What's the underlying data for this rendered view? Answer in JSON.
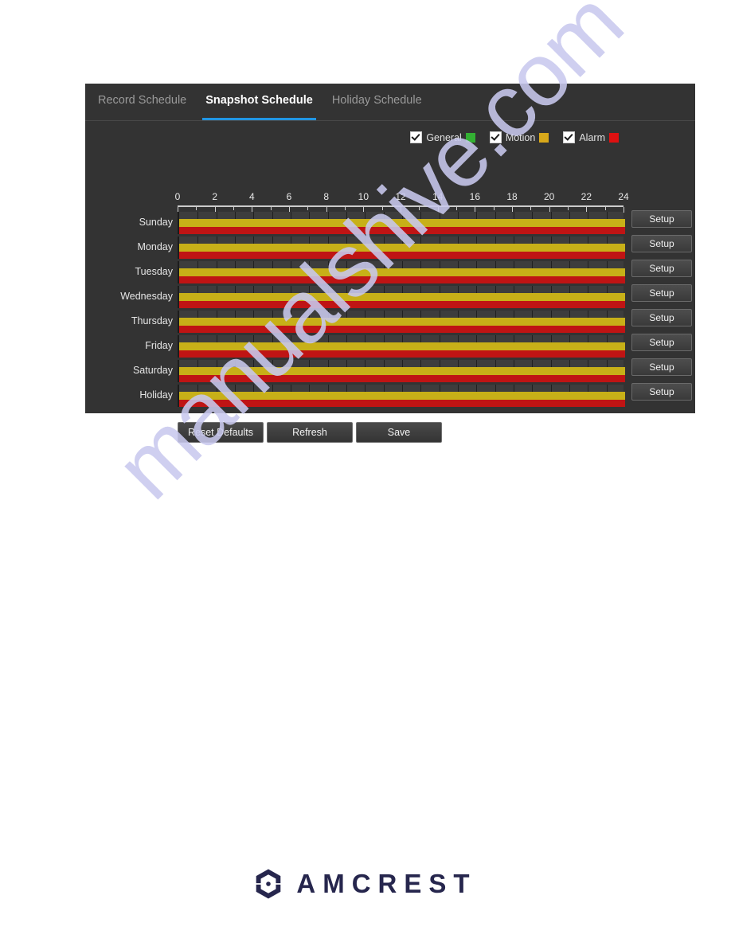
{
  "page": {
    "watermark_text": "manualshive.com",
    "watermark_color": "#c9c9ee",
    "background": "#ffffff"
  },
  "panel": {
    "background": "#333333",
    "accent": "#2196e3"
  },
  "tabs": [
    {
      "label": "Record Schedule",
      "active": false
    },
    {
      "label": "Snapshot Schedule",
      "active": true
    },
    {
      "label": "Holiday Schedule",
      "active": false
    }
  ],
  "legend": {
    "items": [
      {
        "label": "General",
        "color": "#33b033",
        "checked": true
      },
      {
        "label": "Motion",
        "color": "#d8a81a",
        "checked": true
      },
      {
        "label": "Alarm",
        "color": "#dd1111",
        "checked": true
      }
    ]
  },
  "timeline": {
    "axis_labels": [
      "0",
      "2",
      "4",
      "6",
      "8",
      "10",
      "12",
      "14",
      "16",
      "18",
      "20",
      "22",
      "24"
    ],
    "hours_min": 0,
    "hours_max": 24,
    "setup_label": "Setup",
    "track_bg": "#3d3d3d",
    "colors": {
      "general": "#33b033",
      "motion": "#c7b018",
      "alarm": "#bf1414"
    }
  },
  "chart_data": {
    "type": "bar",
    "title": "Snapshot Schedule",
    "xlabel": "",
    "ylabel": "",
    "xlim": [
      0,
      24
    ],
    "grid": true,
    "legend_position": "top-right",
    "categories": [
      "Sunday",
      "Monday",
      "Tuesday",
      "Wednesday",
      "Thursday",
      "Friday",
      "Saturday",
      "Holiday"
    ],
    "series": [
      {
        "name": "General",
        "color": "#33b033",
        "spans": [
          [],
          [],
          [],
          [],
          [],
          [],
          [],
          []
        ]
      },
      {
        "name": "Motion",
        "color": "#c7b018",
        "spans": [
          [
            [
              0,
              24
            ]
          ],
          [
            [
              0,
              24
            ]
          ],
          [
            [
              0,
              24
            ]
          ],
          [
            [
              0,
              24
            ]
          ],
          [
            [
              0,
              24
            ]
          ],
          [
            [
              0,
              24
            ]
          ],
          [
            [
              0,
              24
            ]
          ],
          [
            [
              0,
              24
            ]
          ]
        ]
      },
      {
        "name": "Alarm",
        "color": "#bf1414",
        "spans": [
          [
            [
              0,
              24
            ]
          ],
          [
            [
              0,
              24
            ]
          ],
          [
            [
              0,
              24
            ]
          ],
          [
            [
              0,
              24
            ]
          ],
          [
            [
              0,
              24
            ]
          ],
          [
            [
              0,
              24
            ]
          ],
          [
            [
              0,
              24
            ]
          ],
          [
            [
              0,
              24
            ]
          ]
        ]
      }
    ]
  },
  "rows": [
    {
      "day": "Sunday",
      "setup": "Setup",
      "general": [],
      "motion": [
        [
          0,
          24
        ]
      ],
      "alarm": [
        [
          0,
          24
        ]
      ]
    },
    {
      "day": "Monday",
      "setup": "Setup",
      "general": [],
      "motion": [
        [
          0,
          24
        ]
      ],
      "alarm": [
        [
          0,
          24
        ]
      ]
    },
    {
      "day": "Tuesday",
      "setup": "Setup",
      "general": [],
      "motion": [
        [
          0,
          24
        ]
      ],
      "alarm": [
        [
          0,
          24
        ]
      ]
    },
    {
      "day": "Wednesday",
      "setup": "Setup",
      "general": [],
      "motion": [
        [
          0,
          24
        ]
      ],
      "alarm": [
        [
          0,
          24
        ]
      ]
    },
    {
      "day": "Thursday",
      "setup": "Setup",
      "general": [],
      "motion": [
        [
          0,
          24
        ]
      ],
      "alarm": [
        [
          0,
          24
        ]
      ]
    },
    {
      "day": "Friday",
      "setup": "Setup",
      "general": [],
      "motion": [
        [
          0,
          24
        ]
      ],
      "alarm": [
        [
          0,
          24
        ]
      ]
    },
    {
      "day": "Saturday",
      "setup": "Setup",
      "general": [],
      "motion": [
        [
          0,
          24
        ]
      ],
      "alarm": [
        [
          0,
          24
        ]
      ]
    },
    {
      "day": "Holiday",
      "setup": "Setup",
      "general": [],
      "motion": [
        [
          0,
          24
        ]
      ],
      "alarm": [
        [
          0,
          24
        ]
      ]
    }
  ],
  "actions": [
    {
      "label": "Reset Defaults"
    },
    {
      "label": "Refresh"
    },
    {
      "label": "Save"
    }
  ],
  "footer": {
    "brand": "AMCREST",
    "brand_color": "#26264d",
    "logo_icon": "amcrest-hexagon-logo"
  }
}
